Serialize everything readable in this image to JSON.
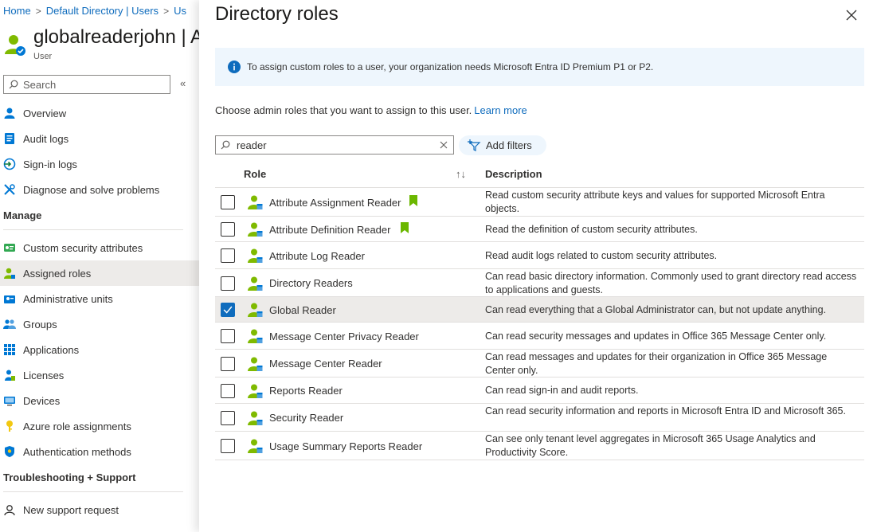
{
  "breadcrumb": [
    {
      "label": "Home"
    },
    {
      "label": "Default Directory | Users"
    },
    {
      "label": "Us"
    }
  ],
  "user": {
    "name": "globalreaderjohn | A",
    "subtitle": "User"
  },
  "sidebar": {
    "search_placeholder": "Search",
    "collapse_glyph": "«",
    "items_top": [
      {
        "label": "Overview",
        "icon": "user-icon"
      },
      {
        "label": "Audit logs",
        "icon": "audit-log-icon"
      },
      {
        "label": "Sign-in logs",
        "icon": "sign-in-icon"
      },
      {
        "label": "Diagnose and solve problems",
        "icon": "wrench-icon"
      }
    ],
    "section_manage": "Manage",
    "items_manage": [
      {
        "label": "Custom security attributes",
        "icon": "attributes-icon"
      },
      {
        "label": "Assigned roles",
        "icon": "assigned-roles-icon",
        "active": true
      },
      {
        "label": "Administrative units",
        "icon": "admin-units-icon"
      },
      {
        "label": "Groups",
        "icon": "groups-icon"
      },
      {
        "label": "Applications",
        "icon": "applications-icon"
      },
      {
        "label": "Licenses",
        "icon": "licenses-icon"
      },
      {
        "label": "Devices",
        "icon": "devices-icon"
      },
      {
        "label": "Azure role assignments",
        "icon": "key-icon"
      },
      {
        "label": "Authentication methods",
        "icon": "shield-icon"
      }
    ],
    "section_support": "Troubleshooting + Support",
    "items_support": [
      {
        "label": "New support request",
        "icon": "support-icon"
      }
    ]
  },
  "blade": {
    "title": "Directory roles",
    "info_text": "To assign custom roles to a user, your organization needs Microsoft Entra ID Premium P1 or P2.",
    "choose_text": "Choose admin roles that you want to assign to this user.",
    "learn_more": "Learn more",
    "search_value": "reader",
    "add_filters": "Add filters",
    "col_role": "Role",
    "col_description": "Description",
    "rows": [
      {
        "role": "Attribute Assignment Reader",
        "bookmark": true,
        "checked": false,
        "description": "Read custom security attribute keys and values for supported Microsoft Entra objects."
      },
      {
        "role": "Attribute Definition Reader",
        "bookmark": true,
        "checked": false,
        "description": "Read the definition of custom security attributes."
      },
      {
        "role": "Attribute Log Reader",
        "bookmark": false,
        "checked": false,
        "description": "Read audit logs related to custom security attributes."
      },
      {
        "role": "Directory Readers",
        "bookmark": false,
        "checked": false,
        "description": "Can read basic directory information. Commonly used to grant directory read access to applications and guests."
      },
      {
        "role": "Global Reader",
        "bookmark": false,
        "checked": true,
        "description": "Can read everything that a Global Administrator can, but not update anything."
      },
      {
        "role": "Message Center Privacy Reader",
        "bookmark": false,
        "checked": false,
        "description": "Can read security messages and updates in Office 365 Message Center only."
      },
      {
        "role": "Message Center Reader",
        "bookmark": false,
        "checked": false,
        "description": "Can read messages and updates for their organization in Office 365 Message Center only."
      },
      {
        "role": "Reports Reader",
        "bookmark": false,
        "checked": false,
        "description": "Can read sign-in and audit reports."
      },
      {
        "role": "Security Reader",
        "bookmark": false,
        "checked": false,
        "description": "Can read security information and reports in Microsoft Entra ID and Microsoft 365."
      },
      {
        "role": "Usage Summary Reports Reader",
        "bookmark": false,
        "checked": false,
        "description": "Can see only tenant level aggregates in Microsoft 365 Usage Analytics and Productivity Score."
      }
    ]
  },
  "colors": {
    "link": "#0f6cbd",
    "selected_row": "#edebe9",
    "info_bg": "#eef6fd",
    "bookmark": "#6bb700"
  }
}
